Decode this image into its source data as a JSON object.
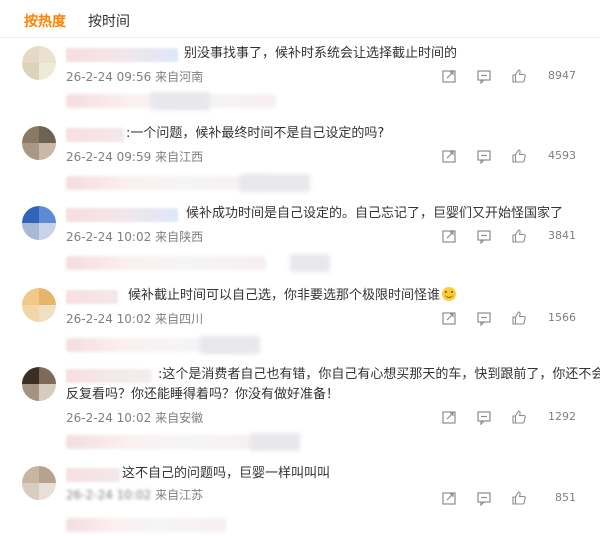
{
  "tabs": {
    "hot": "按热度",
    "time": "按时间"
  },
  "colors": {
    "accent": "#ff8200",
    "meta": "#808080"
  },
  "icons": {
    "share": "share-icon",
    "comment": "comment-icon",
    "like": "thumbs-up-icon"
  },
  "comments": [
    {
      "text": "别没事找事了，候补时系统会让选择截止时间的",
      "time": "26-2-24 09:56",
      "location": "来自河南",
      "likes": "8947"
    },
    {
      "text": ":一个问题，候补最终时间不是自己设定的吗?",
      "time": "26-2-24 09:59",
      "location": "来自江西",
      "likes": "4593"
    },
    {
      "text": "候补成功时间是自己设定的。自己忘记了，巨婴们又开始怪国家了",
      "time": "26-2-24 10:02",
      "location": "来自陕西",
      "likes": "3841"
    },
    {
      "text": "候补截止时间可以自己选，你非要选那个极限时间怪谁",
      "time": "26-2-24 10:02",
      "location": "来自四川",
      "likes": "1566"
    },
    {
      "text": ":这个是消费者自己也有错，你自己有心想买那天的车，快到跟前了，你还不会",
      "text2": "反复看吗？你还能睡得着吗？你没有做好准备！",
      "time": "26-2-24 10:02",
      "location": "来自安徽",
      "likes": "1292"
    },
    {
      "text": "这不自己的问题吗，巨婴一样叫叫叫",
      "time": "26-2-24 10:02",
      "location": "来自江苏",
      "likes": "851"
    }
  ]
}
